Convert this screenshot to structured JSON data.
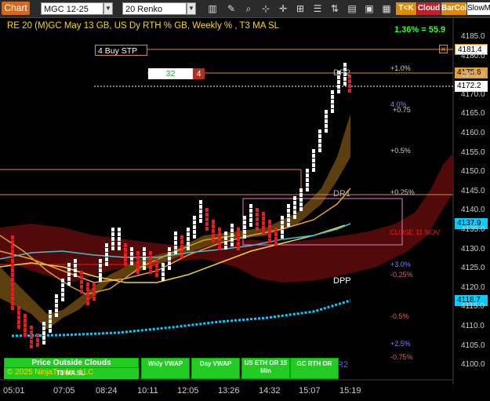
{
  "toolbar": {
    "title": "Chart",
    "instrument": "MGC 12-25",
    "bar_type": "20 Renko",
    "buttons": [
      "T<K",
      "Cloud",
      "BarCol",
      "SlowM"
    ]
  },
  "header": {
    "title": "RE 20  (M)GC May 13 GB, US Dy RTH % GB, Weekly % , T3 MA SL",
    "pct": "1.36% = 55.9"
  },
  "orders": {
    "buy_stop_label": "4 Buy STP",
    "qty_left": "32",
    "qty_right": "4"
  },
  "price_tags": [
    {
      "label": "4181.4",
      "kind": "buy-stop"
    },
    {
      "label": "4175.6",
      "kind": "orange"
    },
    {
      "label": "4172.2",
      "kind": "white"
    },
    {
      "label": "4137.9",
      "kind": "cyan"
    },
    {
      "label": "4118.7",
      "kind": "cyan"
    }
  ],
  "y_axis": [
    "4185.0",
    "4180.0",
    "4175.0",
    "4170.0",
    "4165.0",
    "4160.0",
    "4155.0",
    "4150.0",
    "4145.0",
    "4140.0",
    "4135.0",
    "4130.0",
    "4125.0",
    "4120.0",
    "4115.0",
    "4110.0",
    "4105.0",
    "4100.0"
  ],
  "x_axis": [
    "05:01",
    "07:05",
    "08:24",
    "10:11",
    "12:05",
    "13:26",
    "14:32",
    "15:07",
    "15:19"
  ],
  "pivots": {
    "dr2": "DR2",
    "dr1": "DR1",
    "dpp": "DPP",
    "r2": "R2",
    "close": "CLOSE 11 NOV",
    "plus1": "+1.0%",
    "plus4w": "4.0%",
    "plus075": "+0.75",
    "plus05": "+0.5%",
    "plus025": "+0.25%",
    "plus3w": "+3.0%",
    "minus025": "-0.25%",
    "minus05": "-0.5%",
    "plus25w": "+2.5%",
    "minus075": "-0.75%"
  },
  "bottom": {
    "price_clouds": "Price Outside Clouds",
    "copyright": "© 2025 NinjaTrader, LLC",
    "t3_ma_sl": "T3 MA SL",
    "wkly_vwap": "Wkly VWAP",
    "day_vwap": "Day VWAP",
    "us_eth": "US ETH OR 15 Min",
    "gc_rth": "GC RTH OR"
  },
  "colors": {
    "up_bar": "#ffffff",
    "down_bar": "#e02020",
    "accent_orange": "#d2691e",
    "cyan": "#00cfff",
    "green": "#22cc22"
  }
}
